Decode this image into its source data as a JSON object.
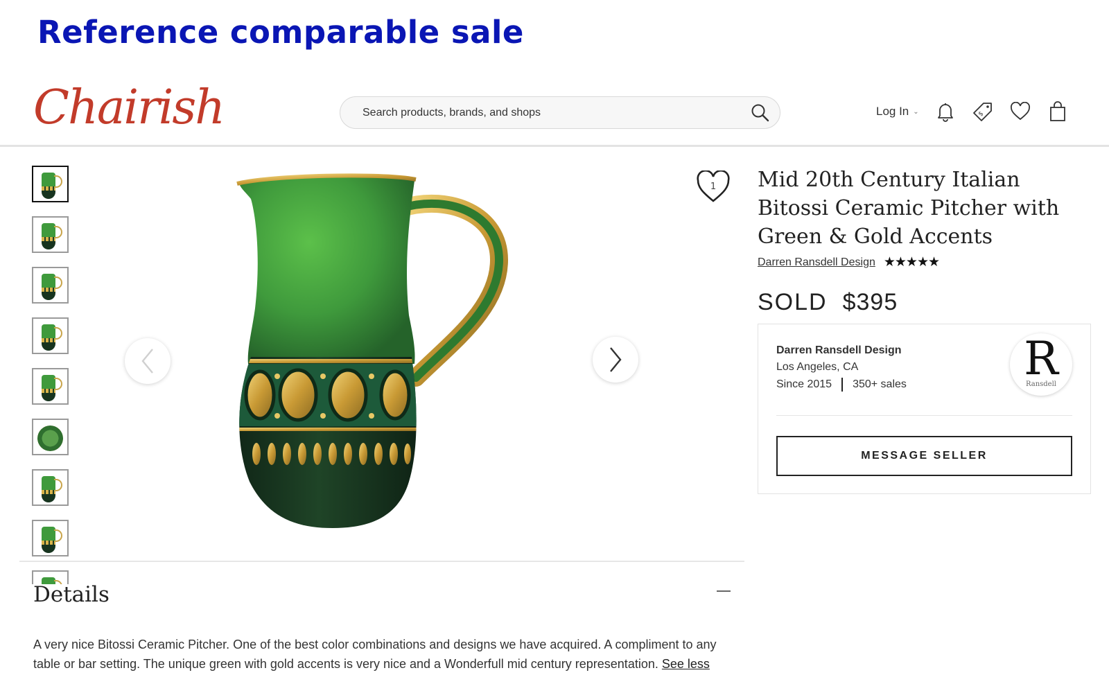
{
  "banner": {
    "text": "Reference comparable sale"
  },
  "header": {
    "logo": "Chairish",
    "search": {
      "placeholder": "Search products, brands, and shops",
      "value": ""
    },
    "login_label": "Log In",
    "icons": [
      "bell-icon",
      "tag-icon",
      "heart-icon",
      "shopping-bag-icon"
    ]
  },
  "gallery": {
    "thumbnail_count": 9,
    "active_index": 0,
    "image": "green-and-gold-ceramic-pitcher",
    "favorites_count": "1"
  },
  "product": {
    "title": "Mid 20th Century Italian Bitossi Ceramic Pitcher with Green & Gold Accents",
    "shop_name": "Darren Ransdell Design",
    "rating_stars": "★★★★★",
    "rating": 5,
    "status": "SOLD",
    "price": "$395"
  },
  "seller": {
    "name": "Darren Ransdell Design",
    "location": "Los Angeles, CA",
    "since": "Since 2015",
    "sales": "350+ sales",
    "logo_monogram": "R",
    "logo_caption": "Ransdell",
    "message_button": "MESSAGE SELLER"
  },
  "details": {
    "heading": "Details",
    "description": "A very nice Bitossi Ceramic Pitcher. One of the best color combinations and designs we have acquired. A compliment to any table or bar setting. The unique green with gold accents is very nice and a Wonderfull mid century representation.",
    "see_less": "See less"
  },
  "colors": {
    "banner": "#0a16b4",
    "logo": "#c23b2a",
    "pitcher_green": "#3f9a3c",
    "pitcher_dark": "#17341f",
    "gold": "#d8b34a"
  }
}
